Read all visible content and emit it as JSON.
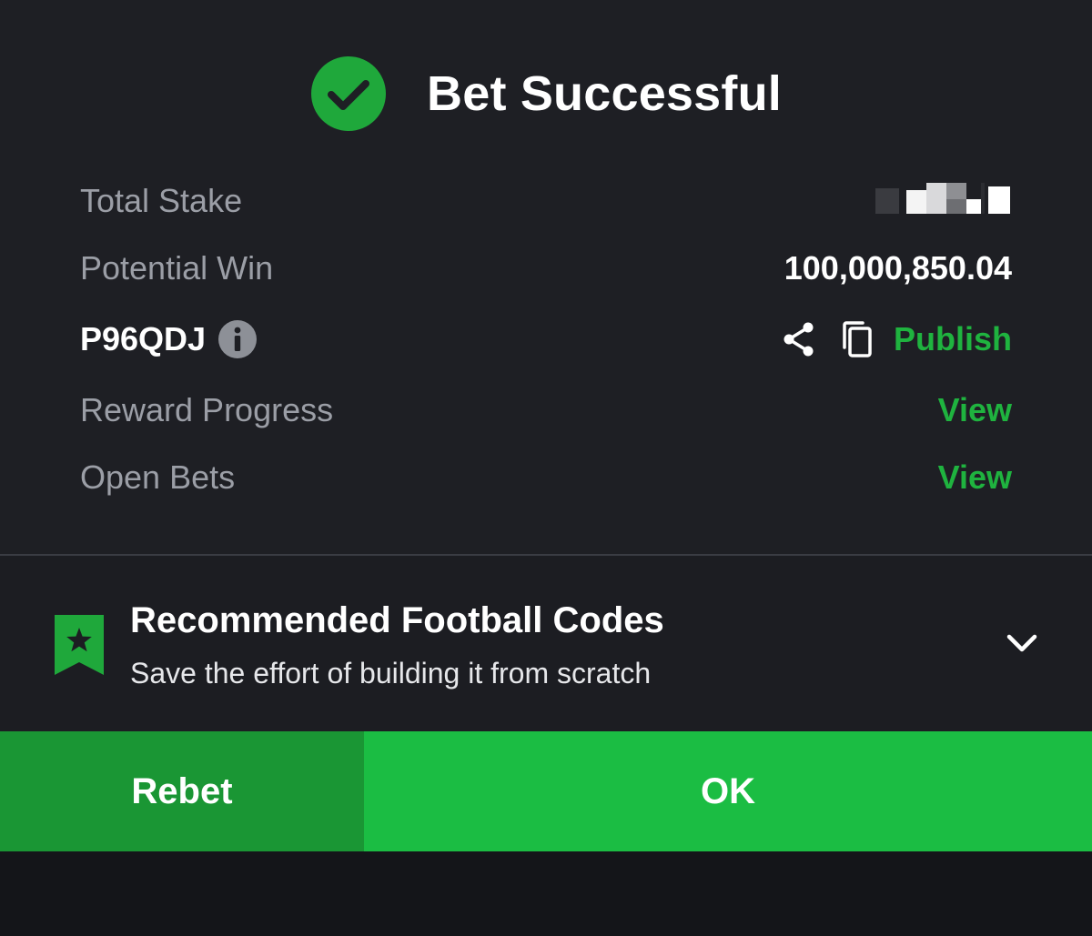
{
  "header": {
    "title": "Bet Successful",
    "icon": "check-circle-icon",
    "icon_color": "#1fa83b"
  },
  "details": {
    "total_stake": {
      "label": "Total Stake",
      "value_redacted": true
    },
    "potential_win": {
      "label": "Potential Win",
      "value": "100,000,850.04"
    },
    "booking": {
      "code": "P96QDJ",
      "icons": [
        "info-icon",
        "share-icon",
        "copy-icon"
      ],
      "publish_label": "Publish"
    },
    "reward_progress": {
      "label": "Reward Progress",
      "link": "View"
    },
    "open_bets": {
      "label": "Open Bets",
      "link": "View"
    }
  },
  "recommended": {
    "icon": "bookmark-star-icon",
    "title": "Recommended Football Codes",
    "subtitle": "Save the effort of building it from scratch",
    "toggle_icon": "chevron-down-icon"
  },
  "actions": {
    "rebet_label": "Rebet",
    "ok_label": "OK"
  },
  "colors": {
    "accent_green": "#1fb33f",
    "rebet_bg": "#1a9634",
    "ok_bg": "#1bbd43",
    "panel_bg": "#1e1f24"
  }
}
